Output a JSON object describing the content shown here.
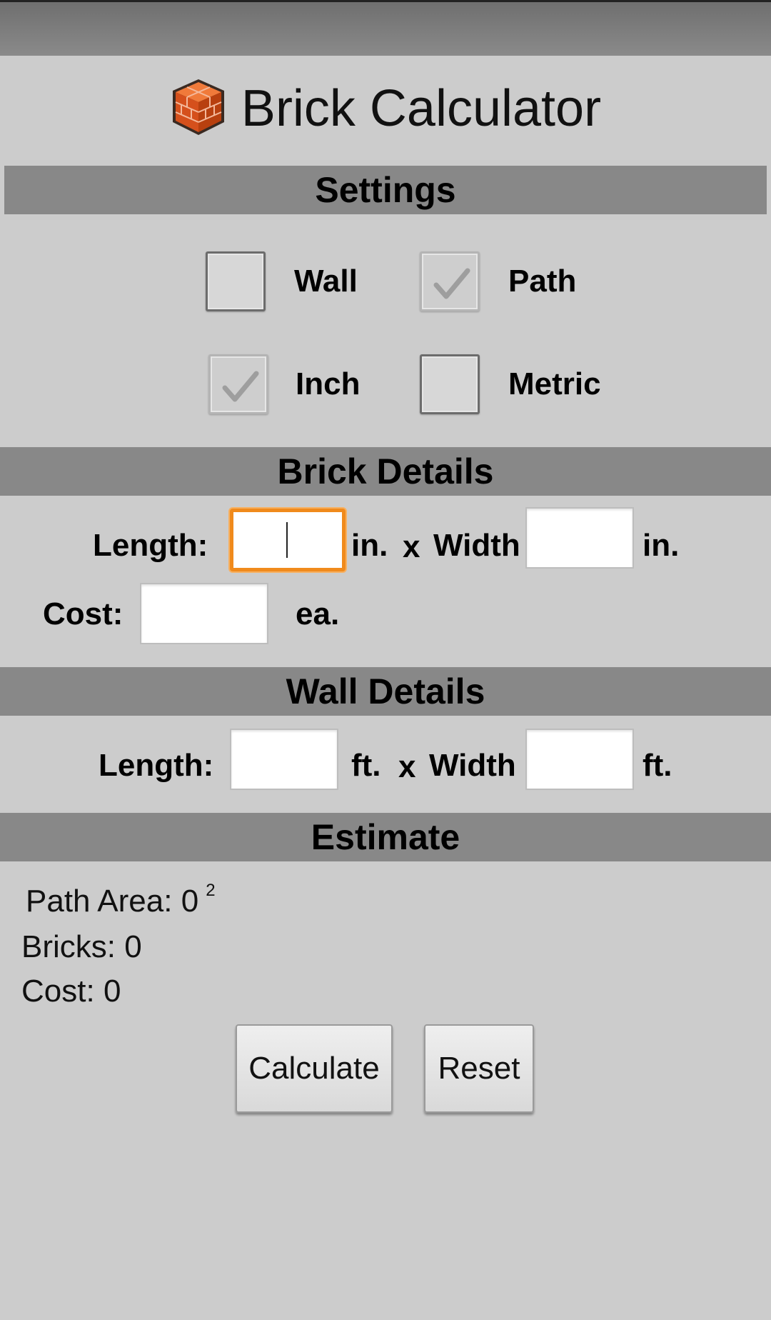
{
  "app": {
    "title": "Brick Calculator",
    "icon": "brick-icon"
  },
  "settings": {
    "header": "Settings",
    "options": {
      "wall": {
        "label": "Wall",
        "checked": false
      },
      "path": {
        "label": "Path",
        "checked": true
      },
      "inch": {
        "label": "Inch",
        "checked": true
      },
      "metric": {
        "label": "Metric",
        "checked": false
      }
    }
  },
  "brick_details": {
    "header": "Brick Details",
    "length_label": "Length:",
    "length_unit": "in.",
    "times": "x",
    "width_label": "Width",
    "width_unit": "in.",
    "cost_label": "Cost:",
    "cost_unit": "ea.",
    "length_value": "",
    "width_value": "",
    "cost_value": ""
  },
  "wall_details": {
    "header": "Wall Details",
    "length_label": "Length:",
    "length_unit": "ft.",
    "times": "x",
    "width_label": "Width",
    "width_unit": "ft.",
    "length_value": "",
    "width_value": ""
  },
  "estimate": {
    "header": "Estimate",
    "path_area_label": "Path Area:",
    "path_area_value": "0",
    "path_area_exponent": "2",
    "bricks_label": "Bricks:",
    "bricks_value": "0",
    "cost_label": "Cost:",
    "cost_value": "0"
  },
  "buttons": {
    "calculate": "Calculate",
    "reset": "Reset"
  },
  "colors": {
    "section_bar": "#888888",
    "background": "#cccccc",
    "focus": "#f08a1c",
    "brick": "#d9581c"
  }
}
